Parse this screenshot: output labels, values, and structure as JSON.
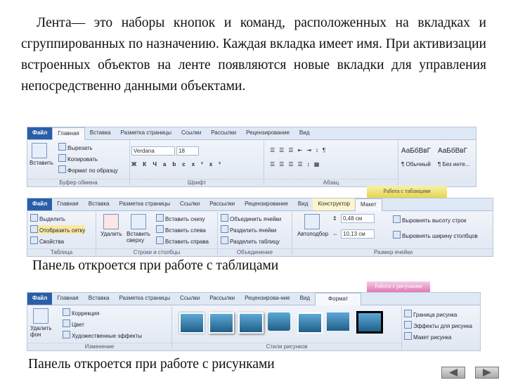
{
  "paragraph": "Лента— это наборы кнопок и команд, расположенных на вкладках и сгруппированных по назначению. Каждая вкладка имеет имя. При активизации встроенных объектов на ленте появляются новые вкладки для управления непосредственно данными объектами.",
  "ribbon1": {
    "tabs": [
      "Файл",
      "Главная",
      "Вставка",
      "Разметка страницы",
      "Ссылки",
      "Рассылки",
      "Рецензирование",
      "Вид"
    ],
    "active_tab": "Главная",
    "clipboard": {
      "paste": "Вставить",
      "cut": "Вырезать",
      "copy": "Копировать",
      "format": "Формат по образцу",
      "label": "Буфер обмена"
    },
    "font": {
      "name": "Verdana",
      "size": "18",
      "label": "Шрифт"
    },
    "paragraph_label": "Абзац",
    "styles": [
      {
        "sample": "АаБбВвГ",
        "name": "¶ Обычный"
      },
      {
        "sample": "АаБбВвГ",
        "name": "¶ Без инте..."
      }
    ]
  },
  "ribbon2": {
    "context_header": "Работа с таблицами",
    "tabs": [
      "Файл",
      "Главная",
      "Вставка",
      "Разметка страницы",
      "Ссылки",
      "Рассылки",
      "Рецензирование",
      "Вид",
      "Конструктор",
      "Макет"
    ],
    "active_tab": "Макет",
    "table_group": {
      "select": "Выделить",
      "grid": "Отобразить сетку",
      "props": "Свойства",
      "label": "Таблица"
    },
    "rows_cols": {
      "delete": "Удалить",
      "insert_top": "Вставить сверху",
      "below": "Вставить снизу",
      "left": "Вставить слева",
      "right": "Вставить справа",
      "label": "Строки и столбцы"
    },
    "merge": {
      "merge": "Объединить ячейки",
      "split": "Разделить ячейки",
      "split_table": "Разделить таблицу",
      "label": "Объединение"
    },
    "autofit": "Автоподбор",
    "size": {
      "height": "0,48 см",
      "width": "10,13 см",
      "rows": "Выровнять высоту строк",
      "cols": "Выровнять ширину столбцов",
      "label": "Размер ячейки"
    }
  },
  "caption1": "Панель откроется при работе с таблицами",
  "ribbon3": {
    "context_header": "Работа с рисунками",
    "tabs": [
      "Файл",
      "Главная",
      "Вставка",
      "Разметка страницы",
      "Ссылки",
      "Рассылки",
      "Рецензирова-ние",
      "Вид",
      "Формат"
    ],
    "active_tab": "Формат",
    "remove_bg": "Удалить фон",
    "adjust": {
      "correction": "Коррекция",
      "color": "Цвет",
      "effects": "Художественные эффекты",
      "label": "Изменение"
    },
    "styles_label": "Стили рисунков",
    "right": {
      "border": "Граница рисунка",
      "effects": "Эффекты для рисунка",
      "layout": "Макет рисунка"
    }
  },
  "caption2": "Панель откроется при работе с рисунками",
  "nav": {
    "prev": "prev-slide",
    "next": "next-slide"
  }
}
